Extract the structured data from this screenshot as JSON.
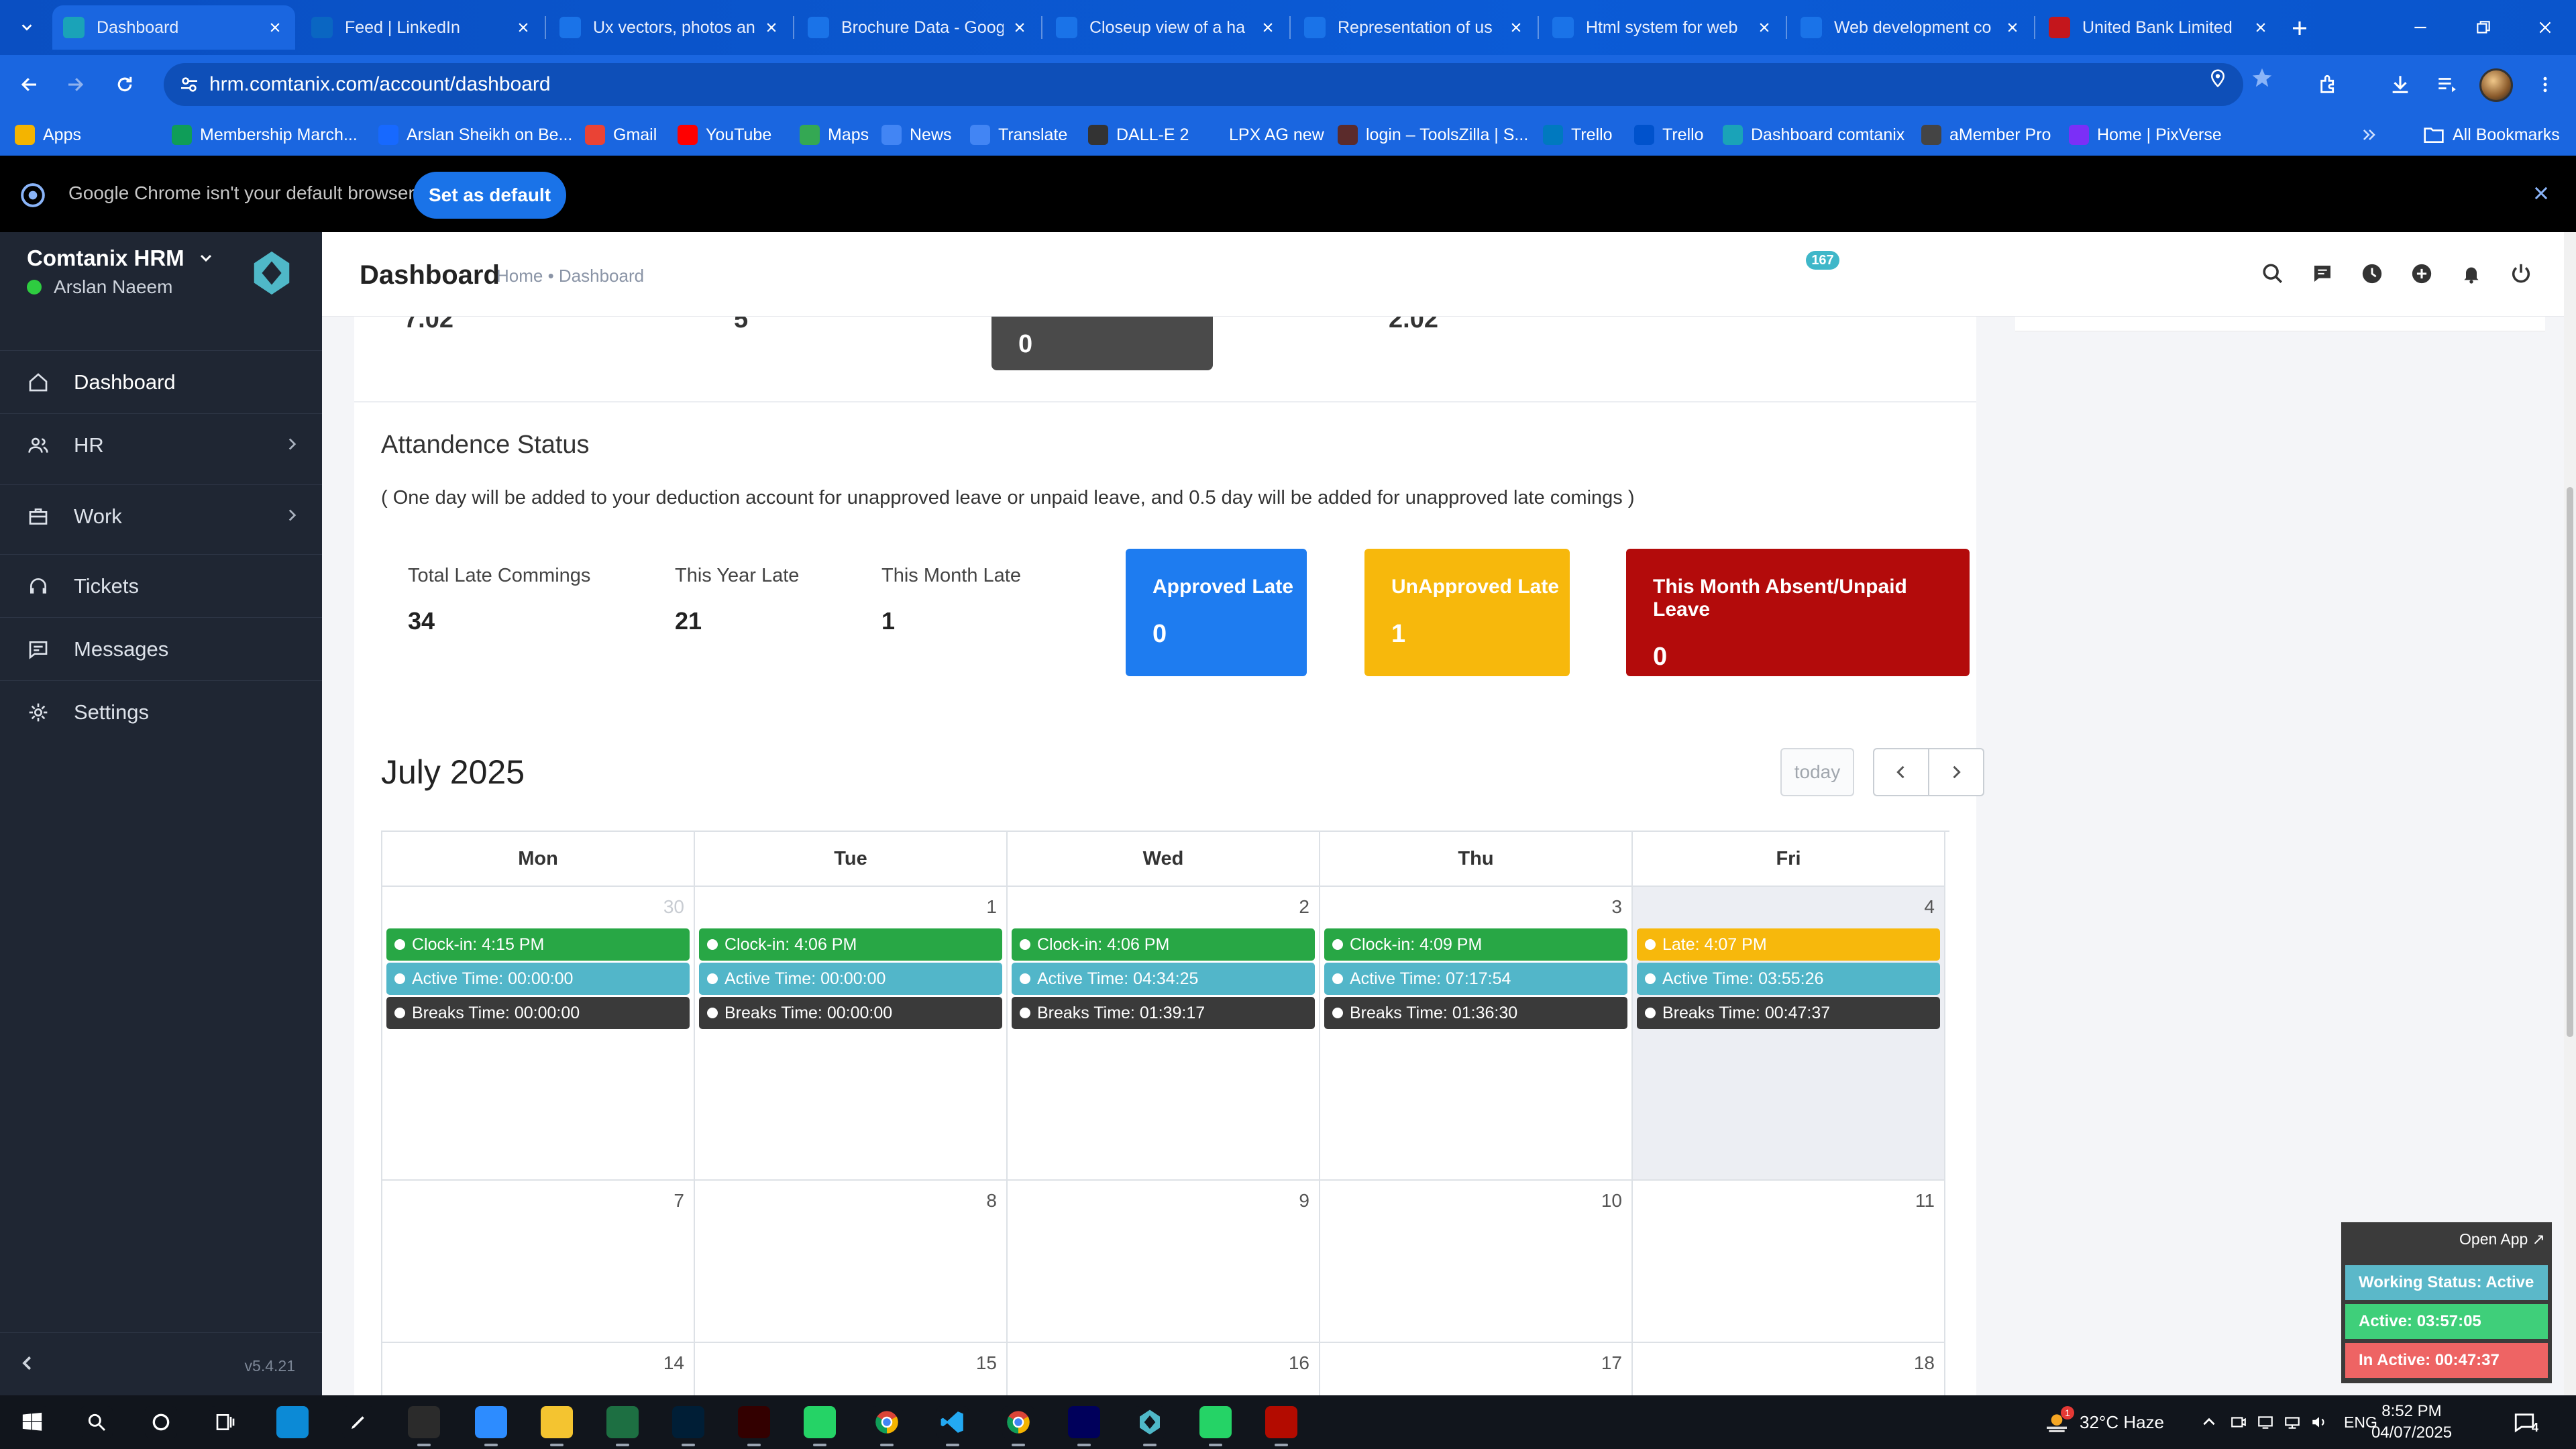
{
  "browser": {
    "tabs": [
      {
        "title": "Dashboard",
        "icon": "comtanix-icon",
        "color": "#1aa3b8",
        "active": true
      },
      {
        "title": "Feed | LinkedIn",
        "icon": "linkedin-icon",
        "color": "#0a66c2"
      },
      {
        "title": "Ux vectors, photos an",
        "icon": "doc-icon",
        "color": "#1a73e8"
      },
      {
        "title": "Brochure Data - Goog",
        "icon": "doc-icon",
        "color": "#1a73e8"
      },
      {
        "title": "Closeup view of a ha",
        "icon": "doc-icon",
        "color": "#1a73e8"
      },
      {
        "title": "Representation of us",
        "icon": "doc-icon",
        "color": "#1a73e8"
      },
      {
        "title": "Html system for web",
        "icon": "doc-icon",
        "color": "#1a73e8"
      },
      {
        "title": "Web development co",
        "icon": "doc-icon",
        "color": "#1a73e8"
      },
      {
        "title": "United Bank Limited",
        "icon": "ubl-icon",
        "color": "#c4161c"
      }
    ],
    "url": "hrm.comtanix.com/account/dashboard",
    "bookmarks": [
      {
        "label": "Apps",
        "icon": "apps-grid-icon",
        "color": "#f4b400"
      },
      {
        "label": "",
        "icon": "grid-icon",
        "color": "#1a66e0"
      },
      {
        "label": "Membership March...",
        "icon": "sheet-icon",
        "color": "#0f9d58"
      },
      {
        "label": "Arslan Sheikh on Be...",
        "icon": "behance-icon",
        "color": "#1769ff"
      },
      {
        "label": "Gmail",
        "icon": "gmail-icon",
        "color": "#ea4335"
      },
      {
        "label": "YouTube",
        "icon": "youtube-icon",
        "color": "#ff0000"
      },
      {
        "label": "Maps",
        "icon": "maps-icon",
        "color": "#34a853"
      },
      {
        "label": "News",
        "icon": "news-icon",
        "color": "#4285f4"
      },
      {
        "label": "Translate",
        "icon": "translate-icon",
        "color": "#4285f4"
      },
      {
        "label": "DALL-E 2",
        "icon": "openai-icon",
        "color": "#333333"
      },
      {
        "label": "LPX AG new",
        "icon": "dots-icon",
        "color": "#1a66e0"
      },
      {
        "label": "login – ToolsZilla | S...",
        "icon": "toolszilla-icon",
        "color": "#5b2b2b"
      },
      {
        "label": "Trello",
        "icon": "trello-icon",
        "color": "#0079bf"
      },
      {
        "label": "Trello",
        "icon": "trello-icon",
        "color": "#0052cc"
      },
      {
        "label": "Dashboard comtanix",
        "icon": "comtanix-icon",
        "color": "#1aa3b8"
      },
      {
        "label": "aMember Pro",
        "icon": "amember-icon",
        "color": "#444444"
      },
      {
        "label": "Home | PixVerse",
        "icon": "pixverse-icon",
        "color": "#7b2ff7"
      }
    ],
    "all_bookmarks": "All Bookmarks",
    "infobar": {
      "text": "Google Chrome isn't your default browser",
      "button": "Set as default"
    }
  },
  "sidebar": {
    "brand": "Comtanix HRM",
    "user": "Arslan Naeem",
    "items": [
      {
        "label": "Dashboard",
        "icon": "home-icon",
        "has_children": false
      },
      {
        "label": "HR",
        "icon": "users-icon",
        "has_children": true
      },
      {
        "label": "Work",
        "icon": "briefcase-icon",
        "has_children": true
      },
      {
        "label": "Tickets",
        "icon": "headset-icon",
        "has_children": false
      },
      {
        "label": "Messages",
        "icon": "message-icon",
        "has_children": false
      },
      {
        "label": "Settings",
        "icon": "gear-icon",
        "has_children": false
      }
    ],
    "version": "v5.4.21"
  },
  "header": {
    "title": "Dashboard",
    "breadcrumb": "Home • Dashboard",
    "notification_count": "167"
  },
  "top_stats": {
    "a": "7.02",
    "b": "5",
    "dark": "0",
    "c": "2.02"
  },
  "attendance": {
    "title": "Attandence Status",
    "note": "( One day will be added to your deduction account for unapproved leave or unpaid leave, and 0.5 day will be added for unapproved late comings )",
    "stats": [
      {
        "label": "Total Late Commings",
        "value": "34"
      },
      {
        "label": "This Year Late",
        "value": "21"
      },
      {
        "label": "This Month Late",
        "value": "1"
      }
    ],
    "cards": [
      {
        "label": "Approved Late",
        "value": "0",
        "color": "#1e7cf0"
      },
      {
        "label": "UnApproved Late",
        "value": "1",
        "color": "#f7b80c"
      },
      {
        "label": "This Month Absent/Unpaid Leave",
        "value": "0",
        "color": "#b30b0b"
      }
    ]
  },
  "calendar": {
    "month": "July 2025",
    "today_label": "today",
    "days": [
      "Mon",
      "Tue",
      "Wed",
      "Thu",
      "Fri"
    ],
    "rows": [
      [
        {
          "num": "30",
          "muted": true,
          "events": [
            {
              "text": "Clock-in: 4:15 PM",
              "color": "#28a745"
            },
            {
              "text": "Active Time: 00:00:00",
              "color": "#52b6c9"
            },
            {
              "text": "Breaks Time: 00:00:00",
              "color": "#3a3a3a"
            }
          ]
        },
        {
          "num": "1",
          "events": [
            {
              "text": "Clock-in: 4:06 PM",
              "color": "#28a745"
            },
            {
              "text": "Active Time: 00:00:00",
              "color": "#52b6c9"
            },
            {
              "text": "Breaks Time: 00:00:00",
              "color": "#3a3a3a"
            }
          ]
        },
        {
          "num": "2",
          "events": [
            {
              "text": "Clock-in: 4:06 PM",
              "color": "#28a745"
            },
            {
              "text": "Active Time: 04:34:25",
              "color": "#52b6c9"
            },
            {
              "text": "Breaks Time: 01:39:17",
              "color": "#3a3a3a"
            }
          ]
        },
        {
          "num": "3",
          "events": [
            {
              "text": "Clock-in: 4:09 PM",
              "color": "#28a745"
            },
            {
              "text": "Active Time: 07:17:54",
              "color": "#52b6c9"
            },
            {
              "text": "Breaks Time: 01:36:30",
              "color": "#3a3a3a"
            }
          ]
        },
        {
          "num": "4",
          "today": true,
          "events": [
            {
              "text": "Late: 4:07 PM",
              "color": "#f7b80c"
            },
            {
              "text": "Active Time: 03:55:26",
              "color": "#52b6c9"
            },
            {
              "text": "Breaks Time: 00:47:37",
              "color": "#3a3a3a"
            }
          ]
        }
      ],
      [
        {
          "num": "7",
          "events": []
        },
        {
          "num": "8",
          "events": []
        },
        {
          "num": "9",
          "events": []
        },
        {
          "num": "10",
          "events": []
        },
        {
          "num": "11",
          "events": []
        }
      ],
      [
        {
          "num": "14",
          "events": []
        },
        {
          "num": "15",
          "events": []
        },
        {
          "num": "16",
          "events": []
        },
        {
          "num": "17",
          "events": []
        },
        {
          "num": "18",
          "events": []
        }
      ]
    ]
  },
  "widget": {
    "open_app": "Open App ↗",
    "working_status": "Working Status: Active",
    "active": "Active: 03:57:05",
    "inactive": "In Active: 00:47:37",
    "colors": {
      "status": "#5bb8c9",
      "active": "#3fcf7a",
      "inactive": "#ee6464"
    }
  },
  "taskbar": {
    "apps": [
      {
        "name": "windows-start-icon"
      },
      {
        "name": "search-icon"
      },
      {
        "name": "cortana-icon"
      },
      {
        "name": "task-view-icon"
      },
      {
        "name": "edge-icon"
      },
      {
        "name": "pen-icon"
      },
      {
        "name": "terminal-icon"
      },
      {
        "name": "zoom-icon"
      },
      {
        "name": "file-explorer-icon"
      },
      {
        "name": "excel-icon"
      },
      {
        "name": "photoshop-icon"
      },
      {
        "name": "illustrator-icon"
      },
      {
        "name": "whatsapp-icon"
      },
      {
        "name": "chrome-icon"
      },
      {
        "name": "vscode-icon"
      },
      {
        "name": "chrome-profile-icon"
      },
      {
        "name": "premiere-icon"
      },
      {
        "name": "comtanix-app-icon"
      },
      {
        "name": "whatsapp-alt-icon"
      },
      {
        "name": "acrobat-icon"
      }
    ],
    "weather": "32°C  Haze",
    "weather_badge": "1",
    "language": "ENG",
    "time": "8:52 PM",
    "date": "04/07/2025",
    "notif_count": "4"
  }
}
